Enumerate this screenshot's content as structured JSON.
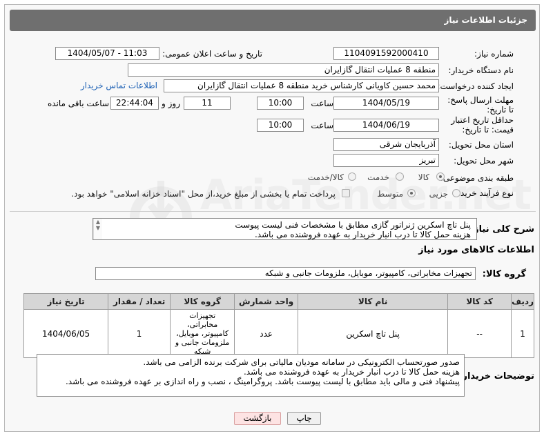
{
  "header": {
    "title": "جزئیات اطلاعات نیاز"
  },
  "fields": {
    "need_number_label": "شماره نیاز:",
    "need_number": "1104091592000410",
    "announce_label": "تاریخ و ساعت اعلان عمومی:",
    "announce_value": "1404/05/07 - 11:03",
    "buyer_org_label": "نام دستگاه خریدار:",
    "buyer_org": "منطقه 8 عملیات انتقال گازایران",
    "creator_label": "ایجاد کننده درخواست:",
    "creator": "محمد حسین کاویانی کارشناس خرید منطقه 8 عملیات انتقال گازایران",
    "contact_link": "اطلاعات تماس خریدار",
    "deadline_label": "مهلت ارسال پاسخ: تا تاریخ:",
    "deadline_date": "1404/05/19",
    "time_label": "ساعت",
    "deadline_time": "10:00",
    "days": "11",
    "days_label": "روز و",
    "remaining": "22:44:04",
    "remaining_label": "ساعت باقی مانده",
    "validity_label": "حداقل تاریخ اعتبار قیمت: تا تاریخ:",
    "validity_date": "1404/06/19",
    "validity_time_label": "ساعت",
    "validity_time": "10:00",
    "province_label": "استان محل تحویل:",
    "province": "آذربایجان شرقی",
    "city_label": "شهر محل تحویل:",
    "city": "تبریز",
    "category_label": "طبقه بندی موضوعی:",
    "category_options": [
      "کالا",
      "خدمت",
      "کالا/خدمت"
    ],
    "process_label": "نوع فرآیند خرید :",
    "process_options": [
      "جزیی",
      "متوسط"
    ],
    "payment_note": "پرداخت تمام یا بخشی از مبلغ خرید،از محل \"اسناد خزانه اسلامی\" خواهد بود."
  },
  "description": {
    "label": "شرح کلی نیاز:",
    "lines": [
      "پنل تاچ اسکرین ژنراتور گازی مطابق با مشخصات فنی لیست پیوست",
      "هزینه حمل کالا تا درب انبار خریدار به عهده فروشنده می باشد."
    ]
  },
  "goods": {
    "section_title": "اطلاعات کالاهای مورد نیاز",
    "group_label": "گروه کالا:",
    "group_value": "تجهیزات مخابراتی، کامپیوتر، موبایل، ملزومات جانبی و شبکه",
    "columns": [
      "ردیف",
      "کد کالا",
      "نام کالا",
      "واحد شمارش",
      "گروه کالا",
      "تعداد / مقدار",
      "تاریخ نیاز"
    ],
    "rows": [
      [
        "1",
        "--",
        "پنل تاچ اسکرین",
        "عدد",
        "تجهیزات مخابراتی، کامپیوتر، موبایل، ملزومات جانبی و شبکه",
        "1",
        "1404/06/05"
      ]
    ]
  },
  "buyer_notes": {
    "label": "توضیحات خریدار:",
    "lines": [
      "صدور صورتحساب الکترونیکی در سامانه مودیان مالیاتی برای شرکت برنده الزامی می باشد.",
      "هزینه حمل کالا تا درب انبار خریدار به عهده فروشنده می باشد.",
      "پیشنهاد فنی و مالی باید مطابق با لیست پیوست باشد. پروگرامینگ ، نصب و راه اندازی بر عهده فروشنده می باشد."
    ]
  },
  "buttons": {
    "print": "چاپ",
    "back": "بازگشت"
  },
  "watermark": {
    "text": "AriaTender.net"
  },
  "icons": {
    "scroll_up": "triangle-up",
    "scroll_down": "triangle-down",
    "watermark_logo": "tender-logo"
  },
  "colors": {
    "header_bg": "#6f6f6f",
    "link": "#1a5fb4",
    "back_button": "#fde3e3"
  }
}
